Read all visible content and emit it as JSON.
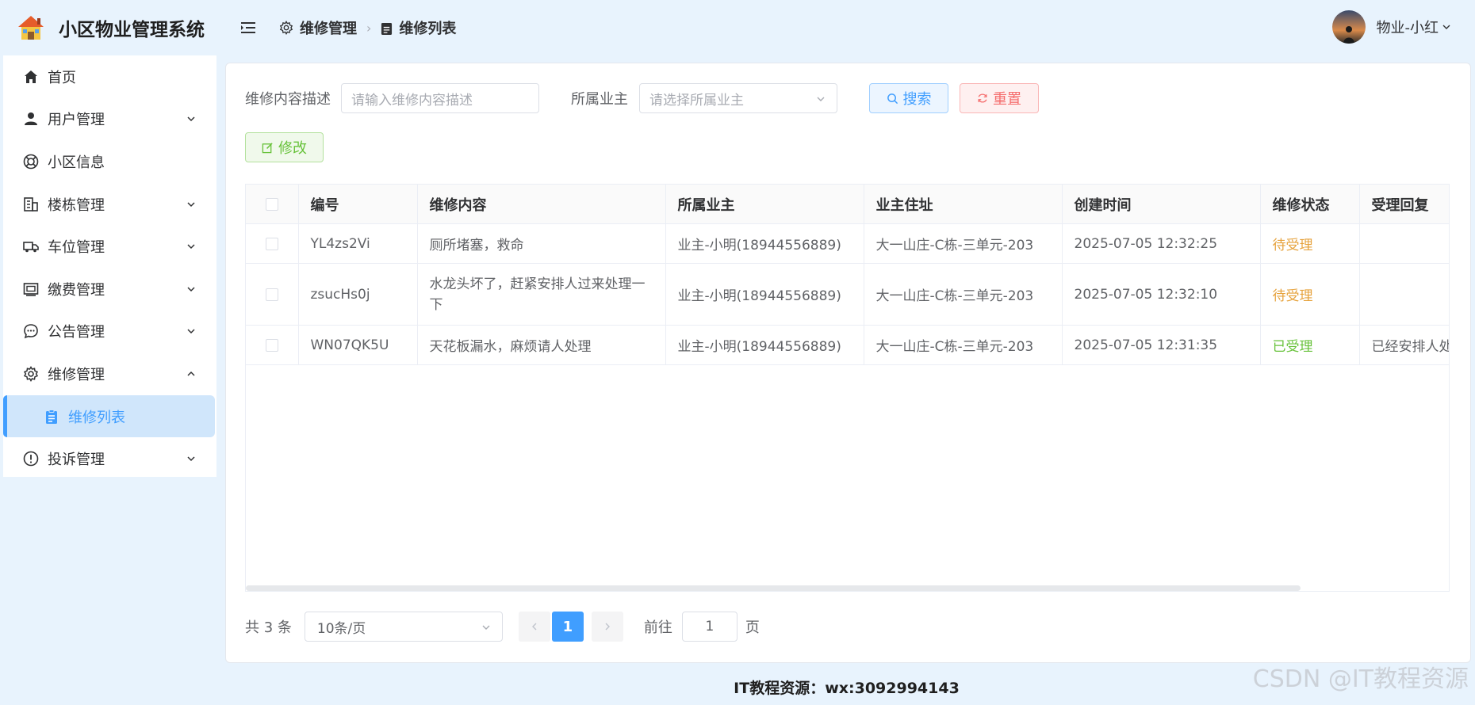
{
  "app": {
    "title": "小区物业管理系统"
  },
  "sidebar": {
    "items": [
      {
        "label": "首页",
        "icon": "home-icon",
        "expandable": false
      },
      {
        "label": "用户管理",
        "icon": "user-icon",
        "expandable": true
      },
      {
        "label": "小区信息",
        "icon": "lifebuoy-icon",
        "expandable": false
      },
      {
        "label": "楼栋管理",
        "icon": "building-icon",
        "expandable": true
      },
      {
        "label": "车位管理",
        "icon": "truck-icon",
        "expandable": true
      },
      {
        "label": "缴费管理",
        "icon": "payment-icon",
        "expandable": true
      },
      {
        "label": "公告管理",
        "icon": "chat-icon",
        "expandable": true
      },
      {
        "label": "维修管理",
        "icon": "gear-icon",
        "expandable": true,
        "expanded": true
      },
      {
        "label": "维修列表",
        "icon": "clipboard-icon",
        "active": true
      },
      {
        "label": "投诉管理",
        "icon": "warning-icon",
        "expandable": true
      }
    ]
  },
  "header": {
    "breadcrumb": [
      "维修管理",
      "维修列表"
    ],
    "user_name": "物业-小红"
  },
  "filters": {
    "desc_label": "维修内容描述",
    "desc_placeholder": "请输入维修内容描述",
    "owner_label": "所属业主",
    "owner_placeholder": "请选择所属业主",
    "search_label": "搜索",
    "reset_label": "重置",
    "edit_label": "修改"
  },
  "table": {
    "columns": [
      "编号",
      "维修内容",
      "所属业主",
      "业主住址",
      "创建时间",
      "维修状态",
      "受理回复"
    ],
    "rows": [
      {
        "id": "YL4zs2Vi",
        "content": "厕所堵塞，救命",
        "owner": "业主-小明(18944556889)",
        "address": "大一山庄-C栋-三单元-203",
        "created": "2025-07-05 12:32:25",
        "status": "待受理",
        "reply": ""
      },
      {
        "id": "zsucHs0j",
        "content": "水龙头坏了，赶紧安排人过来处理一下",
        "owner": "业主-小明(18944556889)",
        "address": "大一山庄-C栋-三单元-203",
        "created": "2025-07-05 12:32:10",
        "status": "待受理",
        "reply": ""
      },
      {
        "id": "WN07QK5U",
        "content": "天花板漏水，麻烦请人处理",
        "owner": "业主-小明(18944556889)",
        "address": "大一山庄-C栋-三单元-203",
        "created": "2025-07-05 12:31:35",
        "status": "已受理",
        "reply": "已经安排人处"
      }
    ]
  },
  "pagination": {
    "total_text": "共 3 条",
    "page_size": "10条/页",
    "current_page": "1",
    "goto_prefix": "前往",
    "goto_value": "1",
    "goto_suffix": "页"
  },
  "footer": {
    "text": "IT教程资源：wx:3092994143"
  },
  "watermark": {
    "text": "CSDN @IT教程资源"
  },
  "colors": {
    "accent": "#409eff",
    "pending": "#e6a23c",
    "done": "#67c23a",
    "danger": "#f56c6c"
  }
}
